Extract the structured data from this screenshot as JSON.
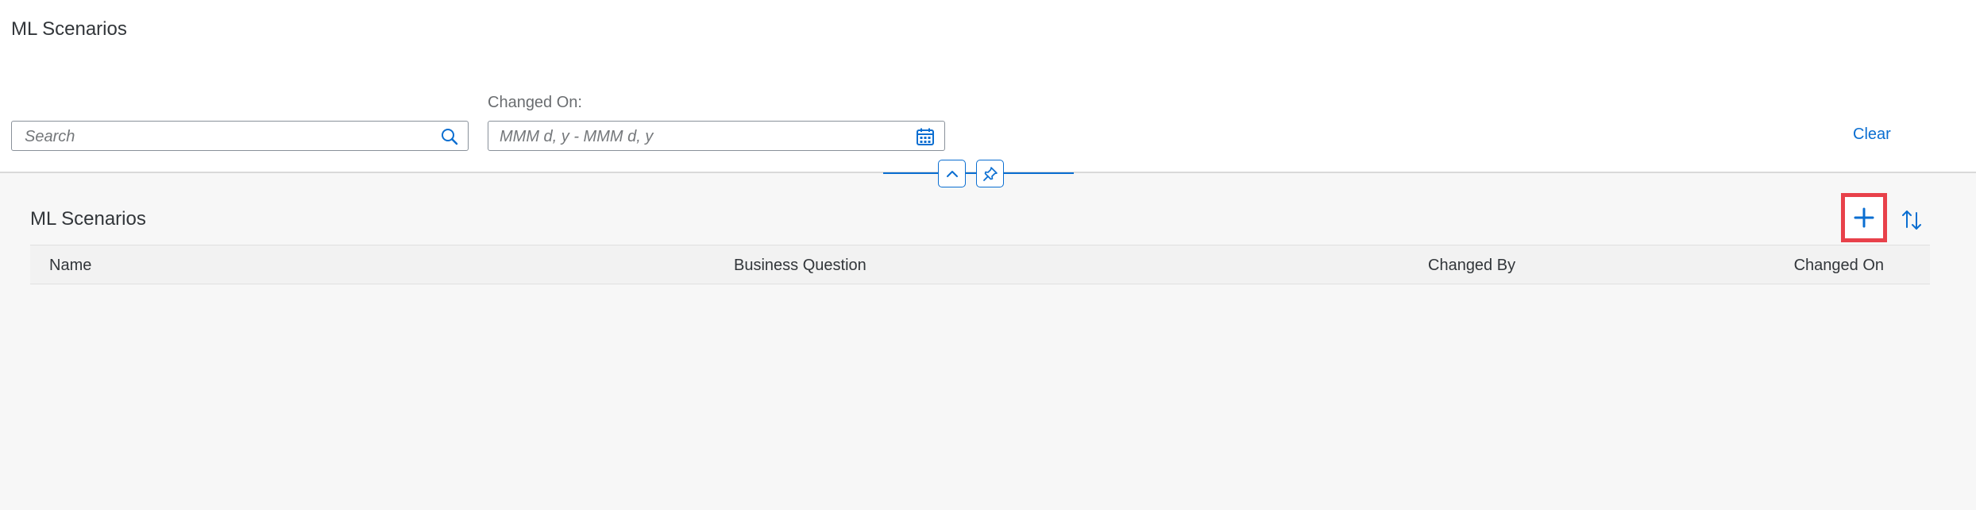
{
  "page": {
    "title": "ML Scenarios"
  },
  "filter_bar": {
    "search_placeholder": "Search",
    "changed_on_label": "Changed On:",
    "date_placeholder": "MMM d, y - MMM d, y",
    "clear_label": "Clear"
  },
  "table": {
    "title": "ML Scenarios",
    "columns": [
      "Name",
      "Business Question",
      "Changed By",
      "Changed On"
    ],
    "rows": []
  },
  "colors": {
    "accent": "#0a6ed1",
    "highlight": "#e8414a"
  },
  "icons": {
    "search": "search-icon",
    "calendar": "calendar-icon",
    "collapse": "chevron-up-icon",
    "pin": "pin-icon",
    "add": "plus-icon",
    "sort": "sort-icon"
  }
}
